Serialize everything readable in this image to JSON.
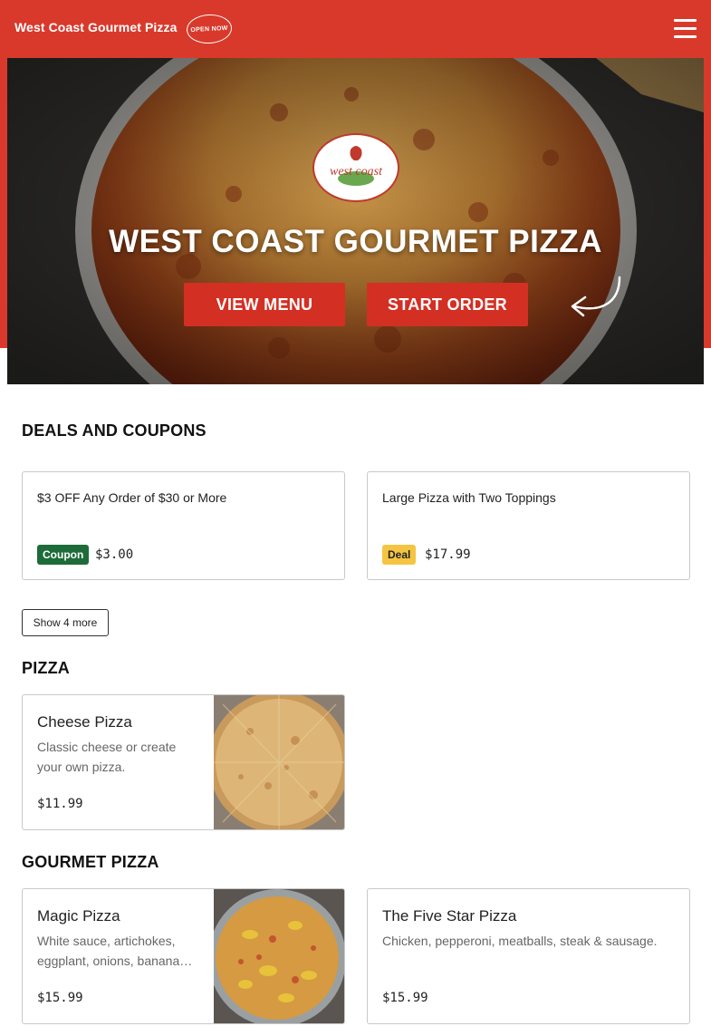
{
  "header": {
    "brand": "West Coast Gourmet Pizza",
    "open_badge": "OPEN NOW",
    "menu_icon": "hamburger-icon"
  },
  "hero": {
    "title": "WEST COAST GOURMET PIZZA",
    "view_menu_label": "VIEW MENU",
    "start_order_label": "START ORDER",
    "logo_text": "west coast"
  },
  "deals": {
    "title": "DEALS AND COUPONS",
    "items": [
      {
        "name": "$3 OFF Any Order of $30 or More",
        "badge": "Coupon",
        "price": "$3.00"
      },
      {
        "name": "Large Pizza with Two Toppings",
        "badge": "Deal",
        "price": "$17.99"
      }
    ],
    "show_more_label": "Show 4 more"
  },
  "pizza": {
    "title": "PIZZA",
    "items": [
      {
        "name": "Cheese Pizza",
        "description": "Classic cheese or create your own pizza.",
        "price": "$11.99"
      }
    ]
  },
  "gourmet": {
    "title": "GOURMET PIZZA",
    "items": [
      {
        "name": "Magic Pizza",
        "description": "White sauce, artichokes, eggplant, onions, banana…",
        "price": "$15.99"
      },
      {
        "name": "The Five Star Pizza",
        "description": "Chicken, pepperoni, meatballs, steak & sausage.",
        "price": "$15.99"
      }
    ]
  },
  "colors": {
    "brand_red": "#d9392b",
    "coupon_green": "#1e6b3a",
    "deal_yellow": "#f5c542"
  }
}
